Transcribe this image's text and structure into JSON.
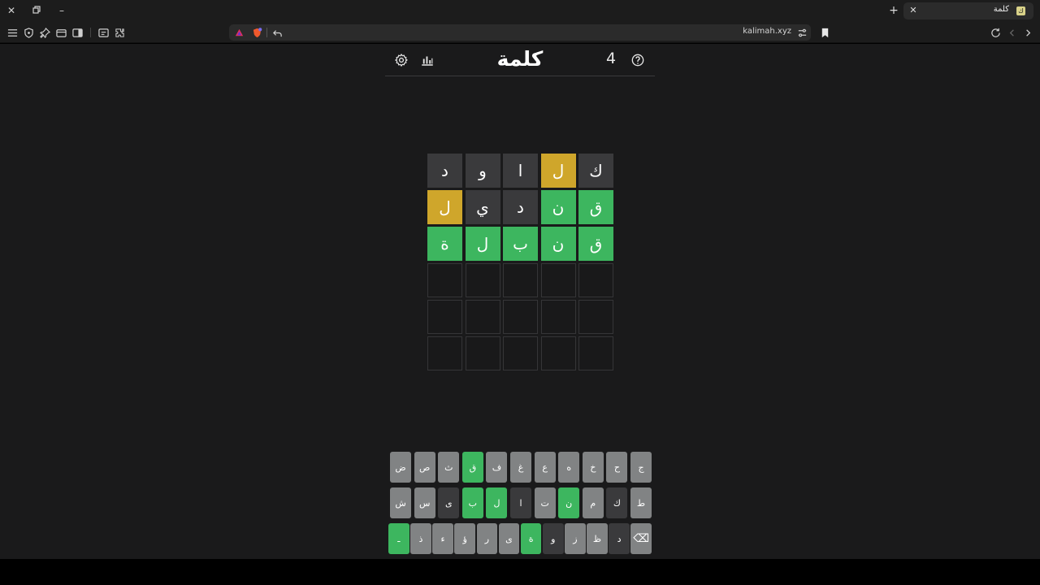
{
  "browser": {
    "tab_title": "كلمة",
    "tab_favicon": "ك",
    "url": "kalimah.xyz",
    "window_controls": [
      "close-icon",
      "restore-icon",
      "minimize-icon"
    ],
    "toolbar_icons": [
      "menu-icon",
      "shield-icon",
      "pin-icon",
      "wallet-icon",
      "sidebar-icon",
      "reader-icon",
      "extensions-icon"
    ]
  },
  "header": {
    "title": "كلمة",
    "streak": "4",
    "icons": [
      "settings-icon",
      "stats-icon",
      "help-icon"
    ]
  },
  "board": [
    [
      {
        "letter": "ك",
        "state": "absent"
      },
      {
        "letter": "ل",
        "state": "present"
      },
      {
        "letter": "ا",
        "state": "absent"
      },
      {
        "letter": "و",
        "state": "absent"
      },
      {
        "letter": "د",
        "state": "absent"
      }
    ],
    [
      {
        "letter": "ق",
        "state": "correct"
      },
      {
        "letter": "ن",
        "state": "correct"
      },
      {
        "letter": "د",
        "state": "absent"
      },
      {
        "letter": "ي",
        "state": "absent"
      },
      {
        "letter": "ل",
        "state": "present"
      }
    ],
    [
      {
        "letter": "ق",
        "state": "correct"
      },
      {
        "letter": "ن",
        "state": "correct"
      },
      {
        "letter": "ب",
        "state": "correct"
      },
      {
        "letter": "ل",
        "state": "correct"
      },
      {
        "letter": "ة",
        "state": "correct"
      }
    ],
    [
      {
        "letter": "",
        "state": "empty"
      },
      {
        "letter": "",
        "state": "empty"
      },
      {
        "letter": "",
        "state": "empty"
      },
      {
        "letter": "",
        "state": "empty"
      },
      {
        "letter": "",
        "state": "empty"
      }
    ],
    [
      {
        "letter": "",
        "state": "empty"
      },
      {
        "letter": "",
        "state": "empty"
      },
      {
        "letter": "",
        "state": "empty"
      },
      {
        "letter": "",
        "state": "empty"
      },
      {
        "letter": "",
        "state": "empty"
      }
    ],
    [
      {
        "letter": "",
        "state": "empty"
      },
      {
        "letter": "",
        "state": "empty"
      },
      {
        "letter": "",
        "state": "empty"
      },
      {
        "letter": "",
        "state": "empty"
      },
      {
        "letter": "",
        "state": "empty"
      }
    ]
  ],
  "keyboard": [
    [
      {
        "k": "ج",
        "s": ""
      },
      {
        "k": "ح",
        "s": ""
      },
      {
        "k": "خ",
        "s": ""
      },
      {
        "k": "ه",
        "s": ""
      },
      {
        "k": "ع",
        "s": ""
      },
      {
        "k": "غ",
        "s": ""
      },
      {
        "k": "ف",
        "s": ""
      },
      {
        "k": "ق",
        "s": "correct"
      },
      {
        "k": "ث",
        "s": ""
      },
      {
        "k": "ص",
        "s": ""
      },
      {
        "k": "ض",
        "s": ""
      }
    ],
    [
      {
        "k": "ط",
        "s": ""
      },
      {
        "k": "ك",
        "s": "absent"
      },
      {
        "k": "م",
        "s": ""
      },
      {
        "k": "ن",
        "s": "correct"
      },
      {
        "k": "ت",
        "s": ""
      },
      {
        "k": "ا",
        "s": "absent"
      },
      {
        "k": "ل",
        "s": "correct"
      },
      {
        "k": "ب",
        "s": "correct"
      },
      {
        "k": "ى",
        "s": "absent"
      },
      {
        "k": "س",
        "s": ""
      },
      {
        "k": "ش",
        "s": ""
      }
    ],
    [
      {
        "k": "⌫",
        "s": ""
      },
      {
        "k": "د",
        "s": "absent"
      },
      {
        "k": "ظ",
        "s": ""
      },
      {
        "k": "ز",
        "s": ""
      },
      {
        "k": "و",
        "s": "absent"
      },
      {
        "k": "ة",
        "s": "correct"
      },
      {
        "k": "ى",
        "s": ""
      },
      {
        "k": "ر",
        "s": ""
      },
      {
        "k": "ؤ",
        "s": ""
      },
      {
        "k": "ء",
        "s": ""
      },
      {
        "k": "ذ",
        "s": ""
      },
      {
        "k": "ـ",
        "s": "correct"
      }
    ]
  ],
  "colors": {
    "correct": "#3db65f",
    "present": "#cfa62b",
    "absent": "#3a3a3c",
    "unused_key": "#818384",
    "background": "#1a1a1b"
  }
}
